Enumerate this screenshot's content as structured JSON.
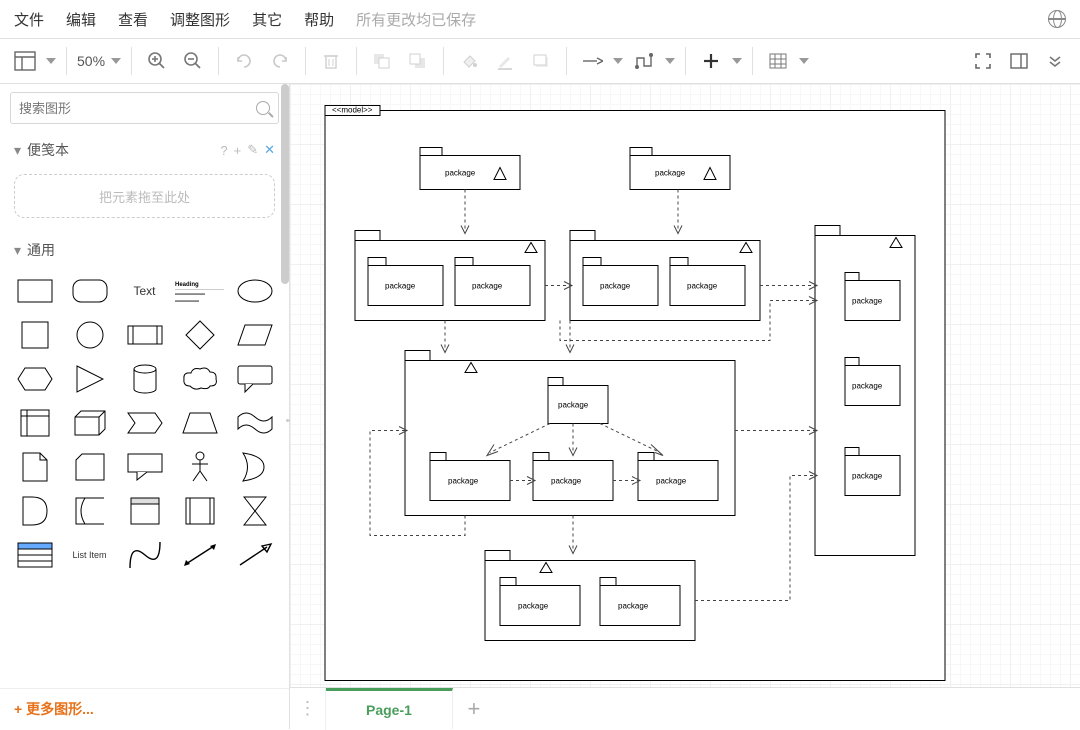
{
  "menu": {
    "file": "文件",
    "edit": "编辑",
    "view": "查看",
    "adjust": "调整图形",
    "other": "其它",
    "help": "帮助",
    "status": "所有更改均已保存"
  },
  "toolbar": {
    "zoom": "50%"
  },
  "sidebar": {
    "search_placeholder": "搜索图形",
    "scratchpad_title": "便笺本",
    "dropzone": "把元素拖至此处",
    "section_general": "通用",
    "shape_text": "Text",
    "shape_listitem": "List Item",
    "heading_sample": "Heading",
    "more": "+ 更多图形..."
  },
  "tabs": {
    "page1": "Page-1",
    "add": "+",
    "handle": "⋮"
  },
  "diagram": {
    "model_label": "<<model>>",
    "package_label": "package"
  }
}
